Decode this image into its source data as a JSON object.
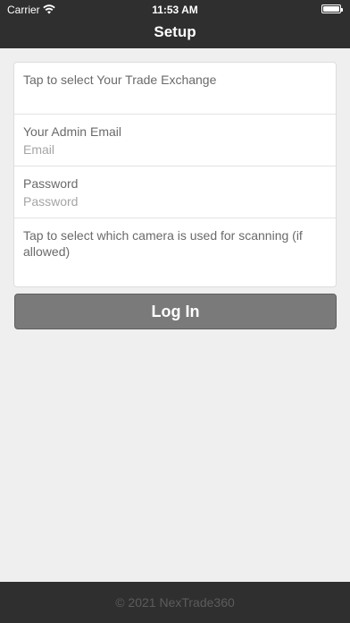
{
  "status_bar": {
    "carrier": "Carrier",
    "time": "11:53 AM",
    "wifi_icon": "wifi-icon",
    "battery_icon": "battery-icon"
  },
  "nav": {
    "title": "Setup"
  },
  "form": {
    "exchange_label": "Tap to select Your Trade Exchange",
    "email_label": "Your Admin Email",
    "email_placeholder": "Email",
    "password_label": "Password",
    "password_placeholder": "Password",
    "camera_label": "Tap to select which camera is used for scanning (if allowed)"
  },
  "actions": {
    "login_label": "Log In"
  },
  "footer": {
    "copyright": "© 2021 NexTrade360"
  },
  "colors": {
    "bar_background": "#2f2f2f",
    "page_background": "#efefef",
    "button_background": "#7a7a7a"
  }
}
